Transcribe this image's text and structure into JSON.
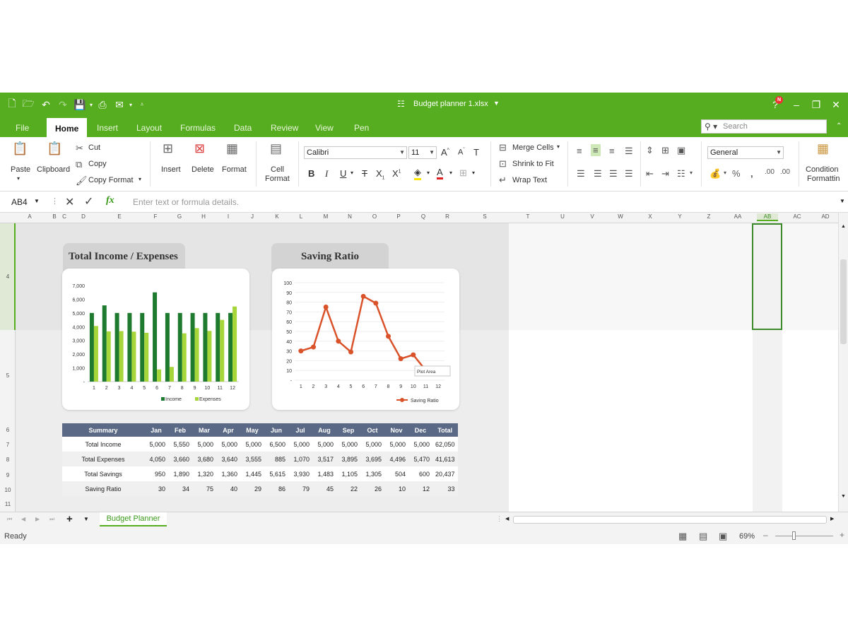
{
  "window": {
    "title": "Budget planner 1.xlsx",
    "notification_badge": "N"
  },
  "menu_tabs": [
    "File",
    "Home",
    "Insert",
    "Layout",
    "Formulas",
    "Data",
    "Review",
    "View",
    "Pen"
  ],
  "search": {
    "placeholder": "Search"
  },
  "ribbon": {
    "paste": "Paste",
    "clipboard": "Clipboard",
    "cut": "Cut",
    "copy": "Copy",
    "copy_format": "Copy Format",
    "insert": "Insert",
    "delete": "Delete",
    "format": "Format",
    "cell_format_1": "Cell",
    "cell_format_2": "Format",
    "font_name": "Calibri",
    "font_size": "11",
    "merge_cells": "Merge Cells",
    "shrink_to_fit": "Shrink to Fit",
    "wrap_text": "Wrap Text",
    "number_format": "General",
    "conditional_1": "Condition",
    "conditional_2": "Formattin"
  },
  "formula_bar": {
    "name_box": "AB4",
    "fx": "fx",
    "placeholder": "Enter text or formula details."
  },
  "columns": [
    "A",
    "B",
    "C",
    "D",
    "E",
    "F",
    "G",
    "H",
    "I",
    "J",
    "K",
    "L",
    "M",
    "N",
    "O",
    "P",
    "Q",
    "R",
    "S",
    "T",
    "U",
    "V",
    "W",
    "X",
    "Y",
    "Z",
    "AA",
    "AB",
    "AC",
    "AD"
  ],
  "rows": [
    "4",
    "5",
    "6",
    "7",
    "8",
    "9",
    "10",
    "11"
  ],
  "cards": {
    "income_title": "Total Income / Expenses",
    "saving_title": "Saving Ratio"
  },
  "chart_data": [
    {
      "type": "bar",
      "categories": [
        "1",
        "2",
        "3",
        "4",
        "5",
        "6",
        "7",
        "8",
        "9",
        "10",
        "11",
        "12"
      ],
      "series": [
        {
          "name": "Income",
          "values": [
            5000,
            5550,
            5000,
            5000,
            5000,
            6500,
            5000,
            5000,
            5000,
            5000,
            5000,
            5000
          ]
        },
        {
          "name": "Expenses",
          "values": [
            4050,
            3660,
            3680,
            3640,
            3555,
            885,
            1070,
            3517,
            3895,
            3695,
            4496,
            5470
          ]
        }
      ],
      "yticks": [
        "-",
        "1,000",
        "2,000",
        "3,000",
        "4,000",
        "5,000",
        "6,000",
        "7,000"
      ],
      "ylim": [
        0,
        7000
      ],
      "legend": "bottom",
      "colors": {
        "Income": "#1e7a2e",
        "Expenses": "#a7d63a"
      }
    },
    {
      "type": "line",
      "categories": [
        "1",
        "2",
        "3",
        "4",
        "5",
        "6",
        "7",
        "8",
        "9",
        "10",
        "11",
        "12"
      ],
      "series": [
        {
          "name": "Saving Ratio",
          "values": [
            30,
            34,
            75,
            40,
            29,
            86,
            79,
            45,
            22,
            26,
            10,
            12
          ]
        }
      ],
      "yticks": [
        "-",
        "10",
        "20",
        "30",
        "40",
        "50",
        "60",
        "70",
        "80",
        "90",
        "100"
      ],
      "ylim": [
        0,
        100
      ],
      "legend": "bottom-right",
      "tooltip": "Plot Area",
      "colors": {
        "Saving Ratio": "#d9522a"
      }
    }
  ],
  "summary_table": {
    "headers": [
      "Summary",
      "Jan",
      "Feb",
      "Mar",
      "Apr",
      "May",
      "Jun",
      "Jul",
      "Aug",
      "Sep",
      "Oct",
      "Nov",
      "Dec",
      "Total"
    ],
    "rows": [
      [
        "Total Income",
        "5,000",
        "5,550",
        "5,000",
        "5,000",
        "5,000",
        "6,500",
        "5,000",
        "5,000",
        "5,000",
        "5,000",
        "5,000",
        "5,000",
        "62,050"
      ],
      [
        "Total Expenses",
        "4,050",
        "3,660",
        "3,680",
        "3,640",
        "3,555",
        "885",
        "1,070",
        "3,517",
        "3,895",
        "3,695",
        "4,496",
        "5,470",
        "41,613"
      ],
      [
        "Total Savings",
        "950",
        "1,890",
        "1,320",
        "1,360",
        "1,445",
        "5,615",
        "3,930",
        "1,483",
        "1,105",
        "1,305",
        "504",
        "600",
        "20,437"
      ],
      [
        "Saving Ratio",
        "30",
        "34",
        "75",
        "40",
        "29",
        "86",
        "79",
        "45",
        "22",
        "26",
        "10",
        "12",
        "33"
      ]
    ]
  },
  "sheet_tab": "Budget Planner",
  "status": {
    "text": "Ready",
    "zoom": "69%"
  }
}
